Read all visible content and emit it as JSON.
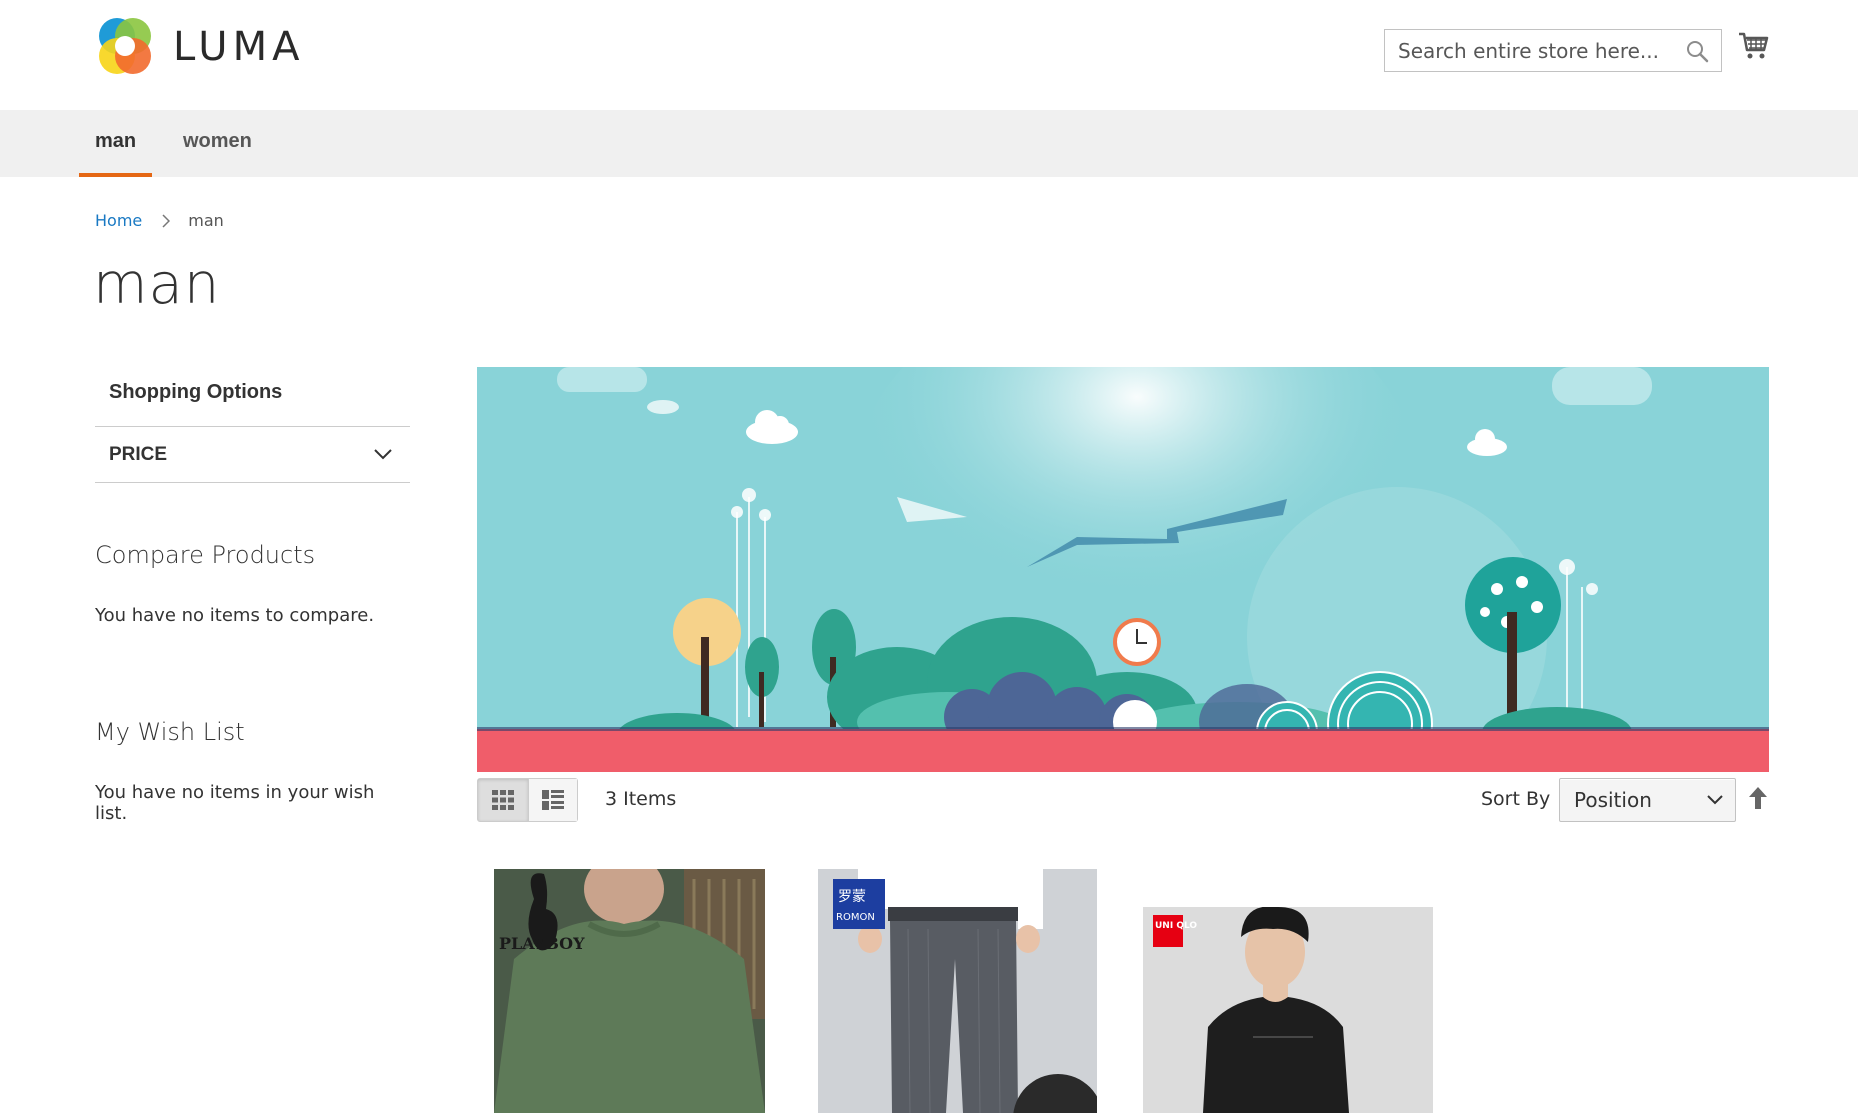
{
  "brand": {
    "name": "LUMA"
  },
  "header": {
    "search_placeholder": "Search entire store here...",
    "search_icon": "search-icon",
    "cart_icon": "shopping-cart-icon"
  },
  "nav": {
    "items": [
      {
        "label": "man",
        "active": true
      },
      {
        "label": "women",
        "active": false
      }
    ]
  },
  "breadcrumb": {
    "home": "Home",
    "current": "man"
  },
  "page_title": "man",
  "sidebar": {
    "shopping_options": "Shopping Options",
    "filters": [
      {
        "label": "PRICE",
        "icon": "chevron-down-icon"
      }
    ],
    "compare": {
      "title": "Compare Products",
      "empty_text": "You have no items to compare."
    },
    "wishlist": {
      "title": "My Wish List",
      "empty_text": "You have no items in your wish list."
    }
  },
  "toolbar": {
    "view_modes": [
      {
        "name": "grid",
        "icon": "grid-view-icon",
        "active": true
      },
      {
        "name": "list",
        "icon": "list-view-icon",
        "active": false
      }
    ],
    "items_count": "3 Items",
    "sort_label": "Sort By",
    "sort_value": "Position",
    "sort_direction_icon": "arrow-up-icon"
  },
  "products": [
    {
      "brand_text": "PLAYBOY",
      "image": "green-sweatshirt"
    },
    {
      "brand_text": "ROMON",
      "image": "grey-trousers"
    },
    {
      "brand_text": "UNI QLO",
      "image": "black-tshirt"
    }
  ],
  "colors": {
    "accent": "#e56714",
    "link": "#1979c3",
    "nav_bg": "#f0f0f0",
    "banner_sky": "#89d3d8",
    "banner_ground": "#f05d6a"
  }
}
